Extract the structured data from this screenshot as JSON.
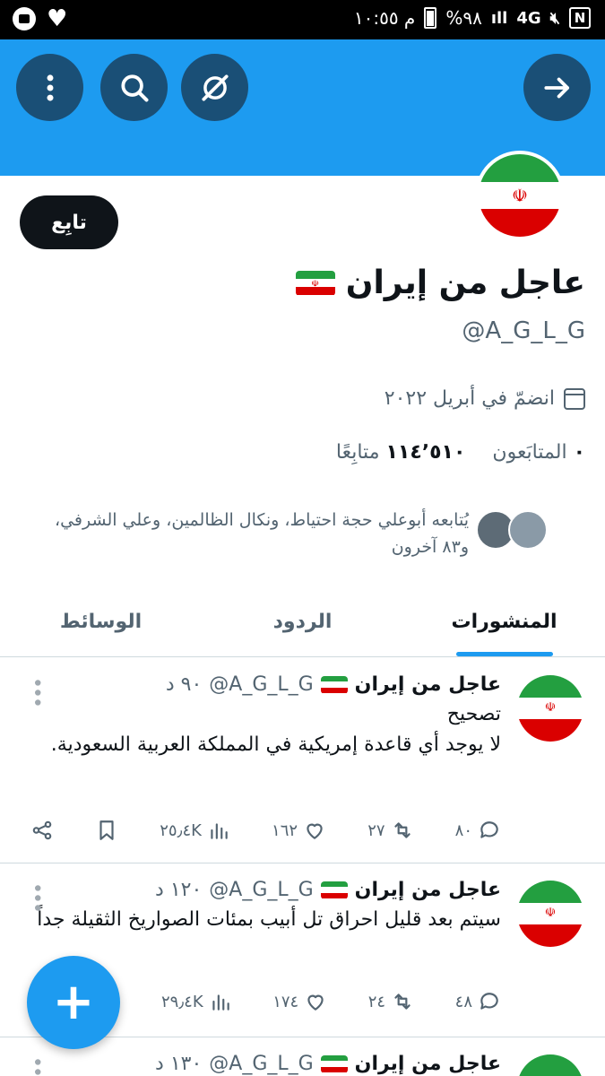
{
  "status_bar": {
    "time": "م ١٠:٥٥",
    "battery": "%٩٨",
    "network": "4G"
  },
  "profile": {
    "follow_label": "تابِع",
    "name": "عاجل من إيران",
    "handle": "@A_G_L_G",
    "joined": "انضمّ في أبريل ٢٠٢٢",
    "following_count": "٠",
    "following_label": "المتابَعون",
    "followers_count": "١١٤٬٥١٠",
    "followers_label": "متابِعًا",
    "followed_by": "يُتابعه أبوعلي حجة احتياط، ونكال الظالمين، وعلي الشرفي، و٨٣ آخرون"
  },
  "tabs": [
    {
      "label": "المنشورات",
      "active": true
    },
    {
      "label": "الردود",
      "active": false
    },
    {
      "label": "الوسائط",
      "active": false
    }
  ],
  "tweets": [
    {
      "name": "عاجل من إيران",
      "handle": "@A_G_L_G",
      "time": "٩٠ د",
      "text_line1": "تصحيح",
      "text_line2": "لا يوجد أي قاعدة إمريكية في المملكة العربية السعودية.",
      "replies": "٨٠",
      "retweets": "٢٧",
      "likes": "١٦٢",
      "views": "٢٥٫٤K"
    },
    {
      "name": "عاجل من إيران",
      "handle": "@A_G_L_G",
      "time": "١٢٠ د",
      "text_line1": "سيتم بعد قليل احراق تل أبيب بمئات الصواريخ الثقيلة جداً",
      "replies": "٤٨",
      "retweets": "٢٤",
      "likes": "١٧٤",
      "views": "٢٩٫٤K"
    },
    {
      "name": "عاجل من إيران",
      "handle": "@A_G_L_G",
      "time": "١٣٠ د"
    }
  ],
  "colors": {
    "accent": "#1d9bf0",
    "header_button": "#1a4f76",
    "text": "#0f1419",
    "secondary_text": "#536471"
  }
}
